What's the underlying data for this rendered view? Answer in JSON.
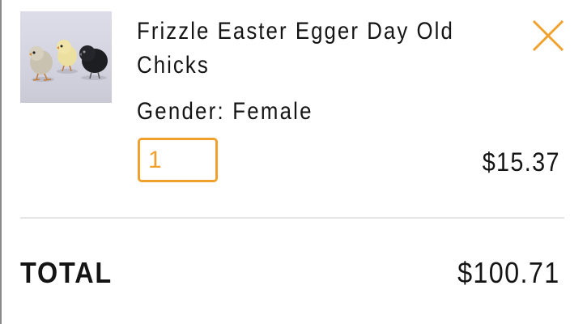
{
  "cart_item": {
    "image_alt": "three day old chicks",
    "title": "Frizzle Easter Egger Day Old Chicks",
    "variant": "Gender: Female",
    "quantity": "1",
    "price": "$15.37",
    "remove_icon": "close-icon"
  },
  "summary": {
    "total_label": "TOTAL",
    "total_value": "$100.71"
  },
  "colors": {
    "accent": "#f0a02c",
    "text": "#141414",
    "divider": "#e6e6e6"
  }
}
